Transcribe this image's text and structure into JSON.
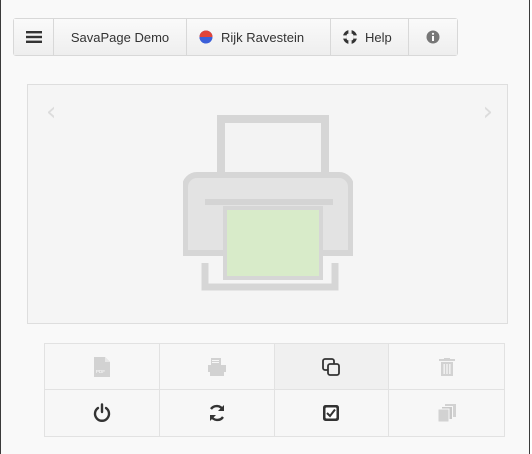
{
  "toolbar": {
    "menu_icon": "hamburger-icon",
    "brand_label": "SavaPage Demo",
    "user_name": "Rijk Ravestein",
    "user_icon": "user-status-icon",
    "help_label": "Help",
    "help_icon": "lifebuoy-icon",
    "info_icon": "info-icon"
  },
  "preview": {
    "prev_icon": "chevron-left-icon",
    "next_icon": "chevron-right-icon",
    "image_icon": "printer-icon"
  },
  "actions": [
    {
      "icon": "pdf-icon",
      "enabled": false
    },
    {
      "icon": "printer-icon",
      "enabled": false
    },
    {
      "icon": "copy-icon",
      "enabled": true
    },
    {
      "icon": "trash-icon",
      "enabled": false
    },
    {
      "icon": "power-icon",
      "enabled": true
    },
    {
      "icon": "refresh-icon",
      "enabled": true
    },
    {
      "icon": "check-square-icon",
      "enabled": true
    },
    {
      "icon": "pages-icon",
      "enabled": false
    }
  ],
  "colors": {
    "accent_blue": "#3b5fd9",
    "accent_red": "#e0443a",
    "paper_green": "#d8ebc9",
    "icon_dark": "#333333",
    "icon_disabled": "#cfcfcf"
  }
}
